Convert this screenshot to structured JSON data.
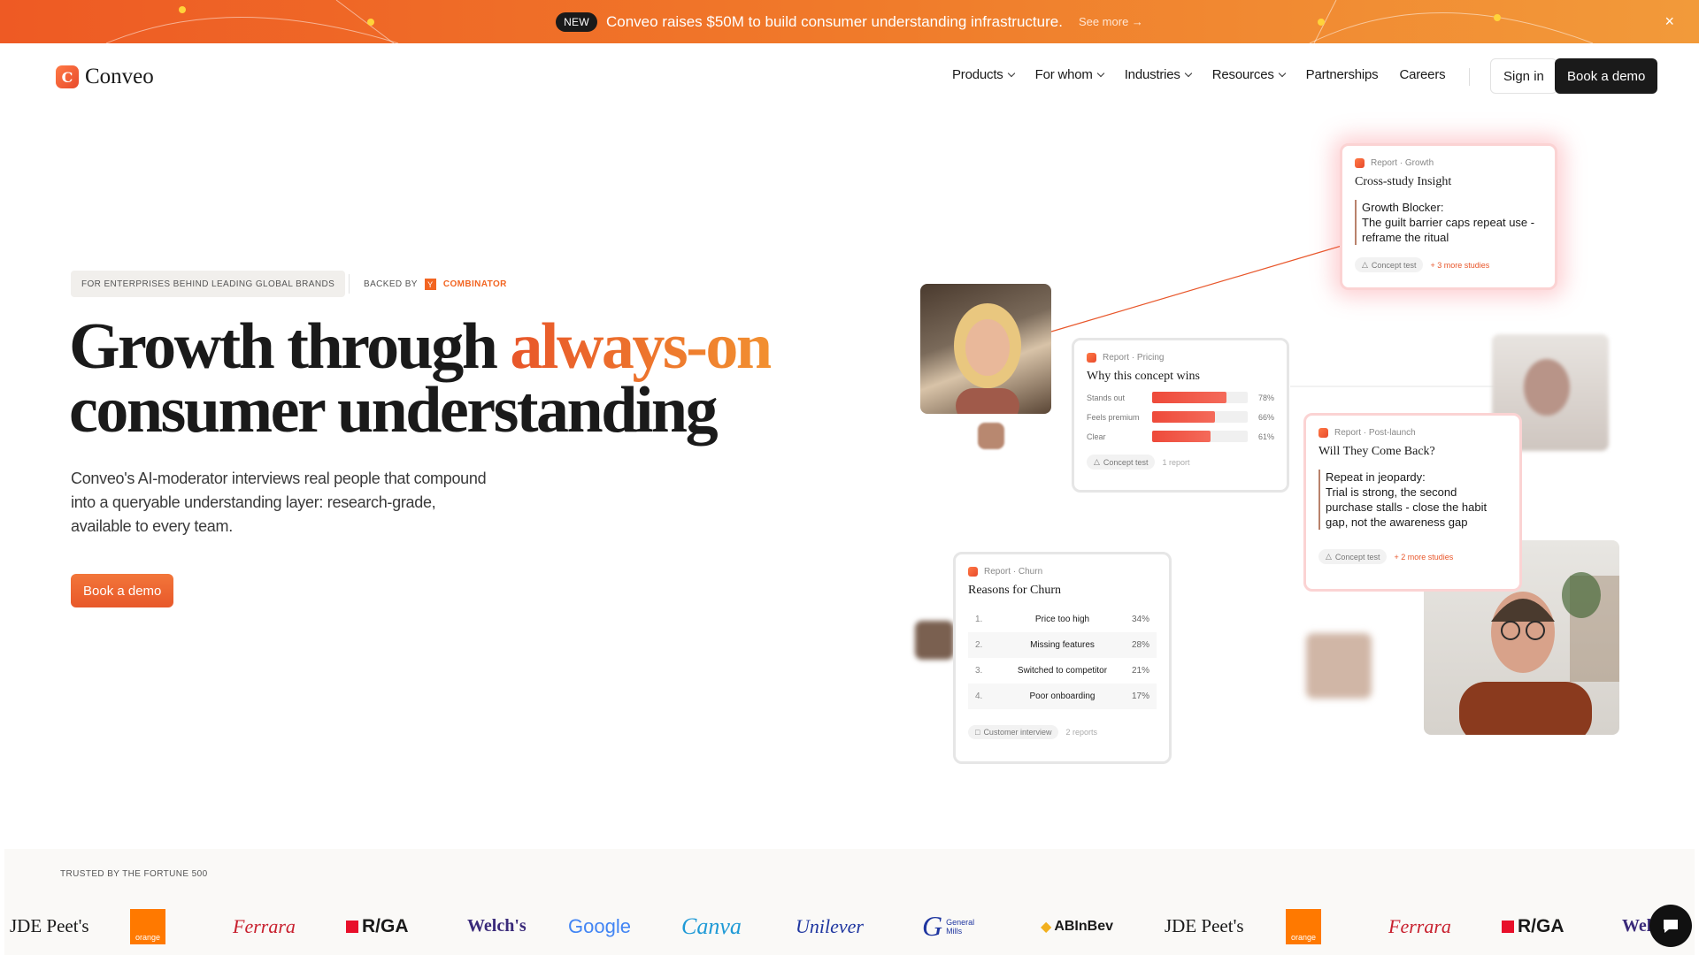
{
  "banner": {
    "badge": "NEW",
    "text": "Conveo raises $50M to build consumer understanding infrastructure.",
    "link": "See more →",
    "close": "×"
  },
  "nav": {
    "logo_mark": "C",
    "logo_text": "Conveo",
    "items": [
      "Products",
      "For whom",
      "Industries",
      "Resources",
      "Partnerships",
      "Careers"
    ],
    "sign_in": "Sign in",
    "book_demo": "Book a demo"
  },
  "hero": {
    "enterprise_pill": "FOR ENTERPRISES BEHIND LEADING GLOBAL BRANDS",
    "backed_by": "BACKED BY",
    "yc_mark": "Y",
    "yc_text": "COMBINATOR",
    "title_line1_plain": "Growth through ",
    "title_line1_accent": "always-on",
    "title_line2": "consumer understanding",
    "subtitle": "Conveo's AI-moderator interviews real people that compound into a queryable understanding layer: research-grade, available to every team.",
    "cta": "Book a demo"
  },
  "cards": {
    "growth": {
      "kicker": "Report · Growth",
      "title": "Cross-study Insight",
      "quote_head": "Growth Blocker:",
      "quote_body": "The guilt barrier caps repeat use - reframe the ritual",
      "tag": "Concept test",
      "extra": "+ 3 more studies"
    },
    "pricing": {
      "kicker": "Report · Pricing",
      "title": "Why this concept wins",
      "bars": [
        {
          "label": "Stands out",
          "value": 78,
          "display": "78%"
        },
        {
          "label": "Feels premium",
          "value": 66,
          "display": "66%"
        },
        {
          "label": "Clear",
          "value": 61,
          "display": "61%"
        }
      ],
      "tag": "Concept test",
      "extra": "1 report"
    },
    "postlaunch": {
      "kicker": "Report · Post-launch",
      "title": "Will They Come Back?",
      "quote_head": "Repeat in jeopardy:",
      "quote_body": "Trial is strong, the second purchase stalls - close the habit gap, not the awareness gap",
      "tag": "Concept test",
      "extra": "+ 2 more studies"
    },
    "churn": {
      "kicker": "Report · Churn",
      "title": "Reasons for Churn",
      "rows": [
        {
          "num": "1.",
          "label": "Price too high",
          "value": "34%"
        },
        {
          "num": "2.",
          "label": "Missing features",
          "value": "28%"
        },
        {
          "num": "3.",
          "label": "Switched to competitor",
          "value": "21%"
        },
        {
          "num": "4.",
          "label": "Poor onboarding",
          "value": "17%"
        }
      ],
      "tag": "Customer interview",
      "extra": "2 reports"
    }
  },
  "trusted": {
    "label": "TRUSTED BY THE FORTUNE 500",
    "brands": [
      "JDE Peet's",
      "orange",
      "Ferrara",
      "R/GA",
      "Welch's",
      "Google",
      "Canva",
      "Unilever",
      "General Mills",
      "ABInBev",
      "JDE Peet's",
      "orange",
      "Ferrara",
      "R/GA",
      "Welch's"
    ]
  },
  "colors": {
    "accent": "#e8562a",
    "accent_light": "#f29030",
    "dark": "#1a1a1a"
  }
}
